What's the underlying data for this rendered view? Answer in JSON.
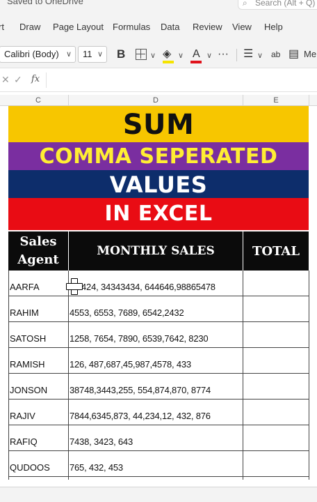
{
  "titlebar": {
    "saved_text": "Saved to OneDrive",
    "search_text": "Search (Alt + Q)"
  },
  "ribbon": {
    "tabs": [
      "rt",
      "Draw",
      "Page Layout",
      "Formulas",
      "Data",
      "Review",
      "View",
      "Help"
    ]
  },
  "toolbar": {
    "font_name": "Calibri (Body)",
    "font_size": "11",
    "bold_label": "B",
    "font_color_label": "A",
    "more_label": "···",
    "wrap_label": "ab",
    "merge_label": "Me",
    "highlight_color": "#f5e400",
    "font_color": "#e0121b"
  },
  "formula_bar": {
    "cancel": "✕",
    "confirm": "✓",
    "fx": "fx",
    "value": ""
  },
  "columns": [
    "C",
    "D",
    "E"
  ],
  "banners": {
    "line1": "SUM",
    "line2": "COMMA SEPERATED",
    "line3": "VALUES",
    "line4": "IN EXCEL"
  },
  "table": {
    "headers": {
      "agent": "Sales Agent",
      "sales": "MONTHLY SALES",
      "total": "TOTAL"
    },
    "rows": [
      {
        "agent": "AARFA",
        "sales": "2424, 34343434, 644646,98865478",
        "total": ""
      },
      {
        "agent": "RAHIM",
        "sales": "4553, 6553, 7689, 6542,2432",
        "total": ""
      },
      {
        "agent": "SATOSH",
        "sales": "1258, 7654, 7890, 6539,7642, 8230",
        "total": ""
      },
      {
        "agent": "RAMISH",
        "sales": "126, 487,687,45,987,4578, 433",
        "total": ""
      },
      {
        "agent": "JONSON",
        "sales": "38748,3443,255, 554,874,870, 8774",
        "total": ""
      },
      {
        "agent": "RAJIV",
        "sales": "7844,6345,873, 44,234,12, 432, 876",
        "total": ""
      },
      {
        "agent": "RAFIQ",
        "sales": "7438, 3423, 643",
        "total": ""
      },
      {
        "agent": "QUDOOS",
        "sales": "765, 432, 453",
        "total": ""
      }
    ]
  },
  "colors": {
    "banner1_bg": "#f7c600",
    "banner2_bg": "#7a2ea0",
    "banner2_text": "#ffee33",
    "banner3_bg": "#0d2d6b",
    "banner4_bg": "#e90c14",
    "header_bg": "#0b0b0b"
  }
}
